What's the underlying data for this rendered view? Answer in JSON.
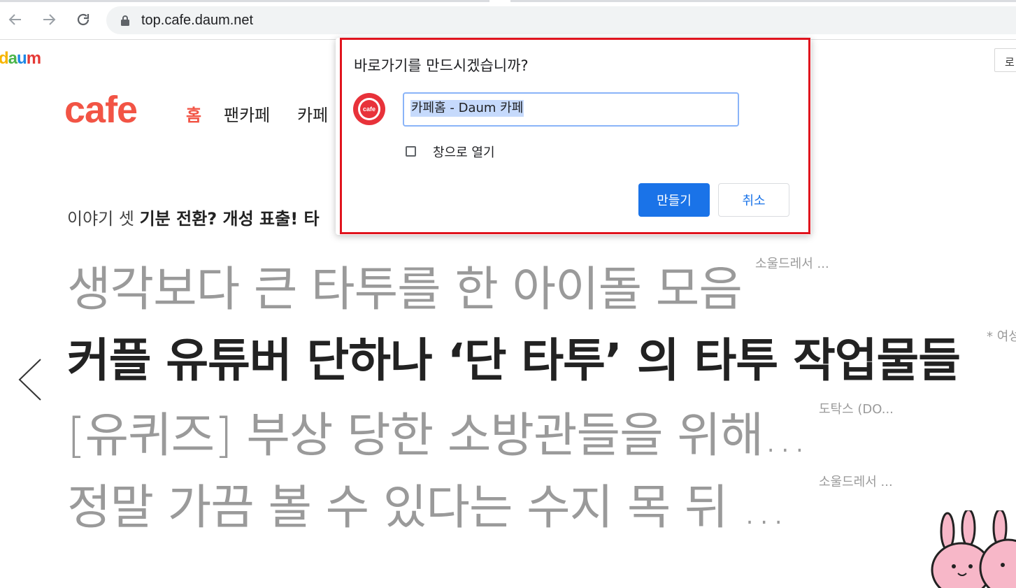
{
  "browser": {
    "url": "top.cafe.daum.net"
  },
  "page": {
    "daum_logo": "daum",
    "login_label": "로",
    "cafe_logo": "cafe",
    "gnb": [
      {
        "label": "홈",
        "active": true
      },
      {
        "label": "팬카페",
        "active": false
      },
      {
        "label": "카페",
        "active": false
      }
    ],
    "story_prefix": "이야기 셋",
    "story_bold": "기분 전환? 개성 표출! 타",
    "headlines": [
      {
        "text": "생각보다 큰 타투를 한 아이돌 모음",
        "source": "소울드레서 ..."
      },
      {
        "text": "커플 유튜버 단하나 ‘단 타투’ 의 타투 작업물들",
        "source": "* 여성"
      },
      {
        "text": "[유퀴즈] 부상 당한 소방관들을 위해...",
        "source": "도탁스 (DO..."
      },
      {
        "text": "정말 가끔 볼 수 있다는 수지 목 뒤 ...",
        "source": "소울드레서 ..."
      }
    ]
  },
  "dialog": {
    "title": "바로가기를 만드시겠습니까?",
    "favicon_text": "cafe",
    "input_value": "카페홈 - Daum 카페",
    "checkbox_label": "창으로 열기",
    "checkbox_checked": false,
    "create_label": "만들기",
    "cancel_label": "취소",
    "accent_color": "#1a73e8",
    "highlight_color": "#e0141e"
  }
}
